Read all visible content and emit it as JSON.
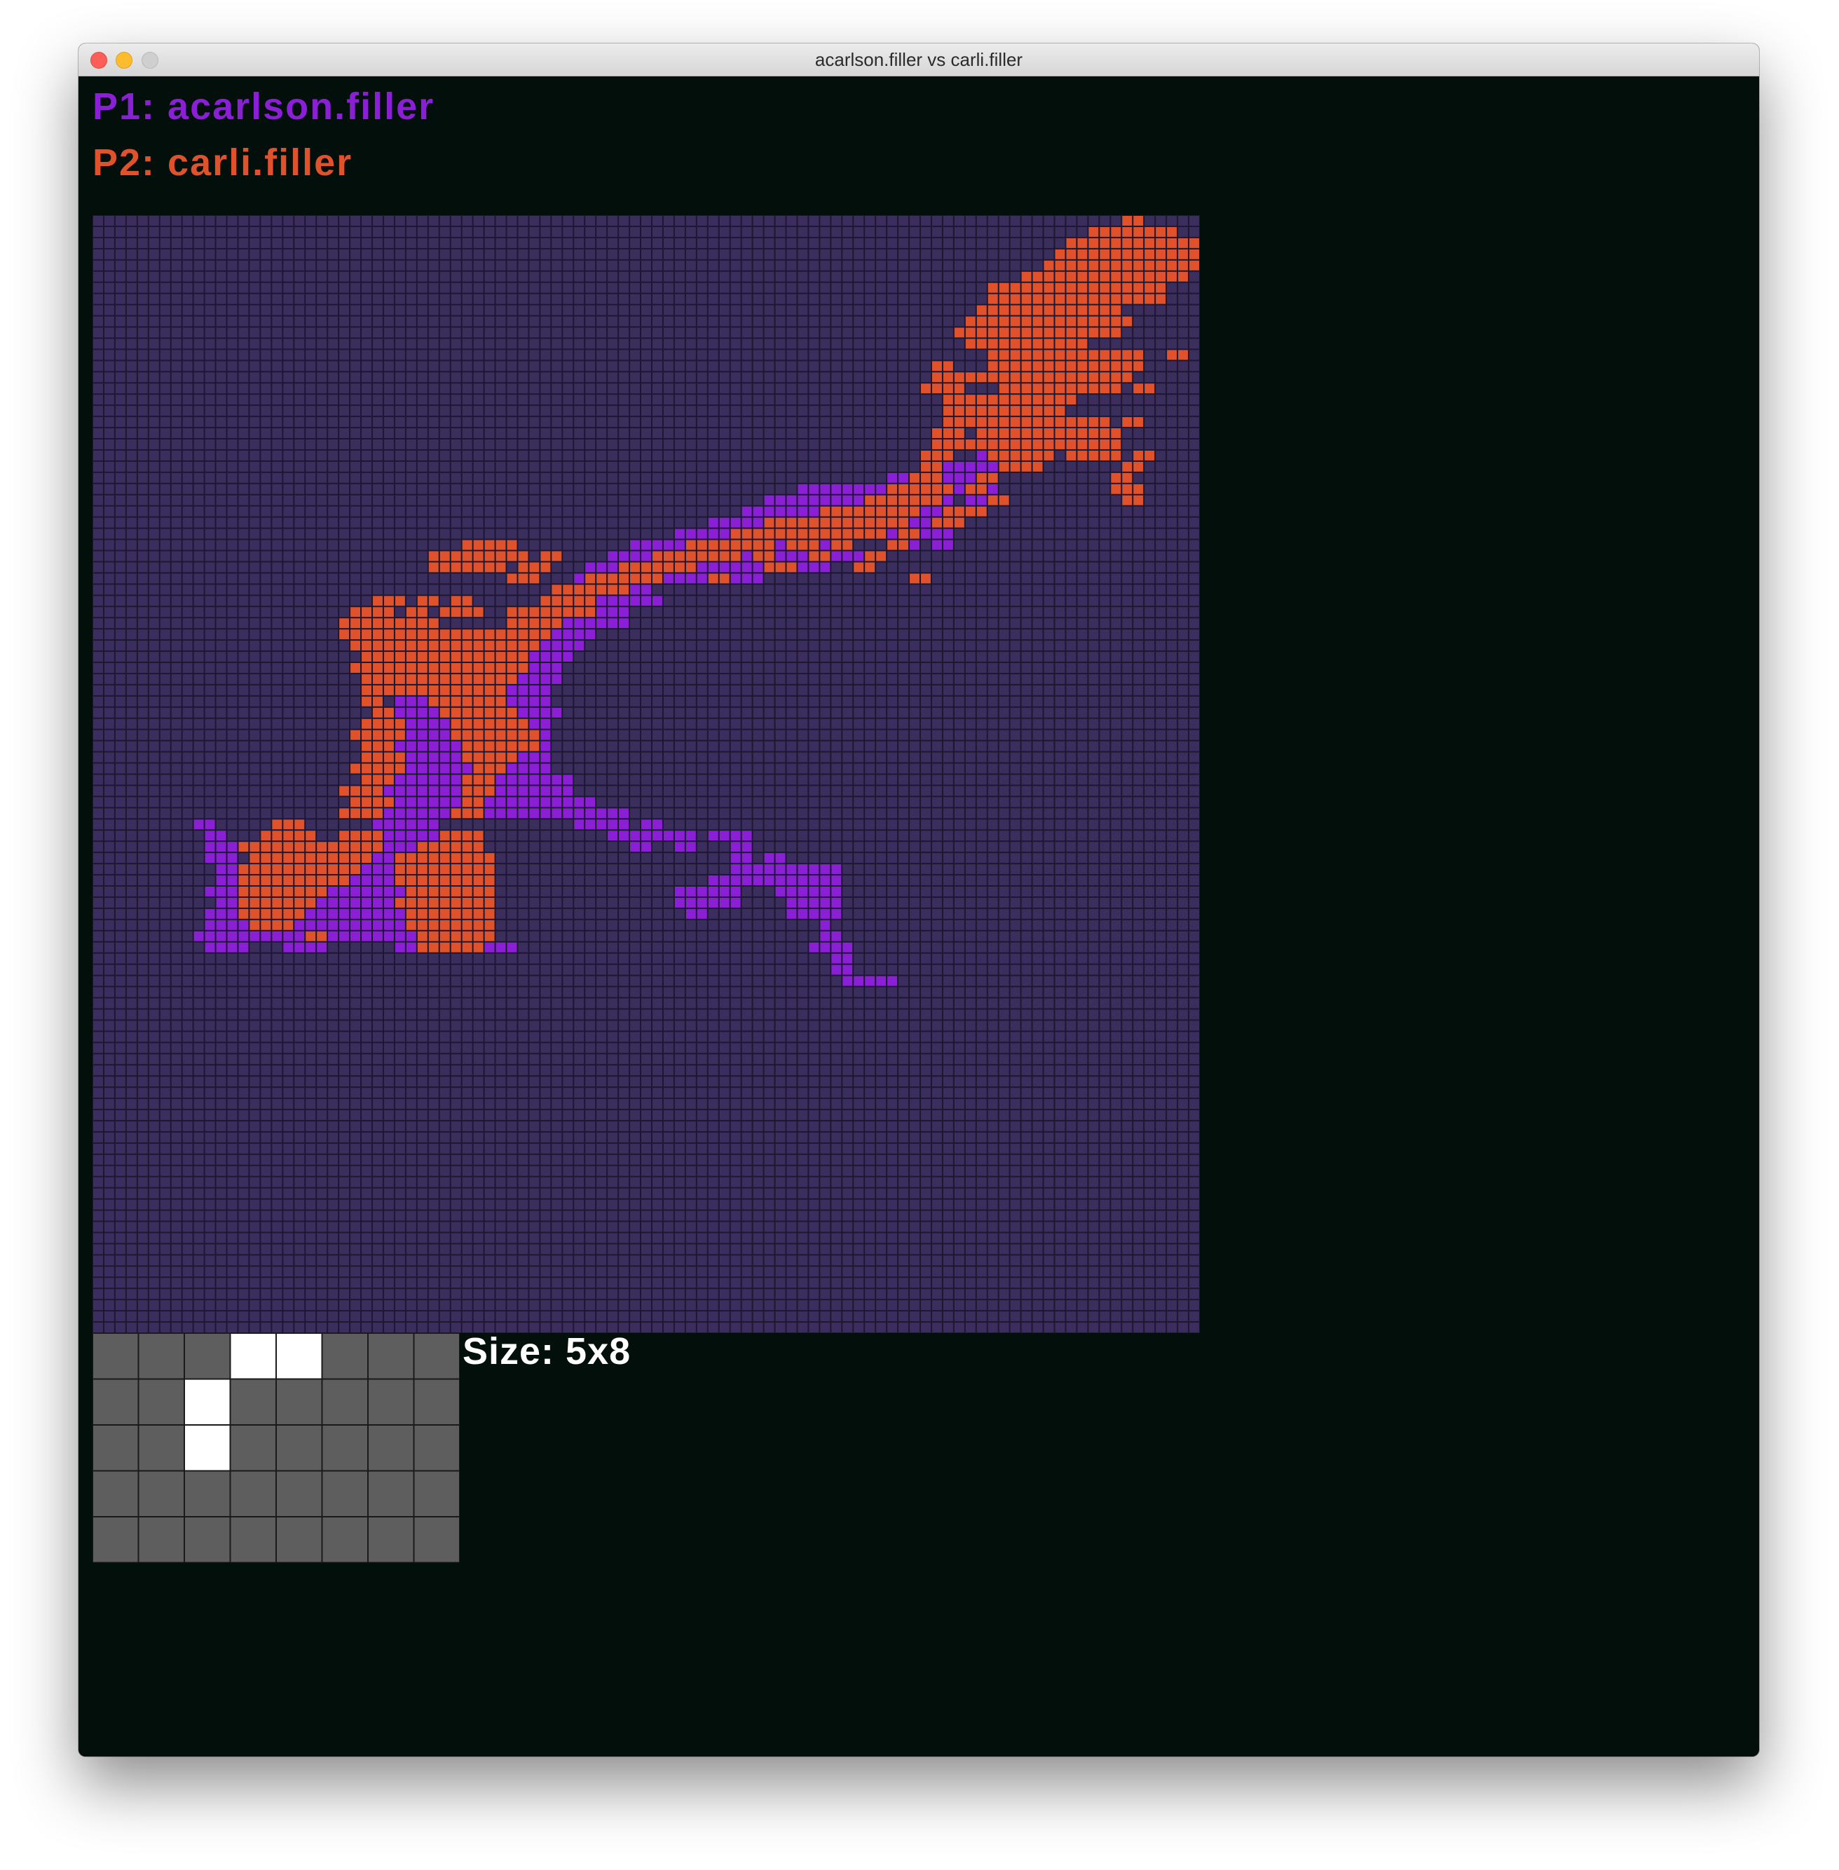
{
  "window": {
    "title": "acarlson.filler vs carli.filler"
  },
  "players": [
    {
      "label": "P1: acarlson.filler",
      "color": "#8a1fd6"
    },
    {
      "label": "P2: carli.filler",
      "color": "#e0522c"
    }
  ],
  "colors": {
    "empty": "#3b2d5e",
    "grid": "#1c1830",
    "piece_empty": "#5e5e5e",
    "piece_filled": "#ffffff",
    "piece_grid": "#1a1a1a"
  },
  "board": {
    "rows": 100,
    "cols": 99,
    "p2_regions": [
      [
        0,
        92,
        0,
        93
      ],
      [
        1,
        89,
        1,
        96
      ],
      [
        2,
        87,
        2,
        98
      ],
      [
        3,
        86,
        3,
        98
      ],
      [
        4,
        85,
        4,
        98
      ],
      [
        5,
        83,
        5,
        97
      ],
      [
        6,
        80,
        7,
        95
      ],
      [
        7,
        83,
        8,
        91
      ],
      [
        8,
        79,
        8,
        86
      ],
      [
        9,
        78,
        9,
        92
      ],
      [
        10,
        77,
        10,
        91
      ],
      [
        11,
        78,
        11,
        88
      ],
      [
        12,
        80,
        13,
        93
      ],
      [
        14,
        82,
        14,
        92
      ],
      [
        15,
        81,
        15,
        91
      ],
      [
        15,
        93,
        15,
        94
      ],
      [
        12,
        96,
        12,
        97
      ],
      [
        16,
        78,
        16,
        87
      ],
      [
        17,
        76,
        17,
        86
      ],
      [
        18,
        77,
        18,
        90
      ],
      [
        19,
        79,
        20,
        91
      ],
      [
        21,
        80,
        21,
        85
      ],
      [
        21,
        90,
        21,
        91
      ],
      [
        22,
        81,
        22,
        82
      ],
      [
        22,
        92,
        22,
        93
      ],
      [
        21,
        93,
        21,
        94
      ],
      [
        13,
        75,
        13,
        76
      ],
      [
        14,
        75,
        14,
        81
      ],
      [
        15,
        74,
        15,
        77
      ],
      [
        16,
        76,
        19,
        77
      ],
      [
        19,
        75,
        20,
        76
      ],
      [
        20,
        78,
        20,
        79
      ],
      [
        21,
        75,
        21,
        76
      ],
      [
        21,
        87,
        21,
        89
      ],
      [
        22,
        83,
        22,
        84
      ],
      [
        17,
        81,
        17,
        82
      ],
      [
        23,
        91,
        23,
        92
      ],
      [
        24,
        91,
        24,
        93
      ],
      [
        25,
        92,
        25,
        93
      ],
      [
        18,
        92,
        18,
        93
      ],
      [
        16,
        77,
        16,
        78
      ],
      [
        17,
        77,
        17,
        79
      ],
      [
        18,
        78,
        18,
        80
      ],
      [
        20,
        76,
        20,
        78
      ],
      [
        21,
        74,
        21,
        75
      ],
      [
        22,
        74,
        22,
        75
      ],
      [
        23,
        73,
        23,
        75
      ],
      [
        24,
        71,
        24,
        76
      ],
      [
        25,
        69,
        25,
        75
      ],
      [
        26,
        65,
        26,
        73
      ],
      [
        27,
        60,
        27,
        72
      ],
      [
        28,
        57,
        28,
        70
      ],
      [
        29,
        53,
        29,
        60
      ],
      [
        30,
        50,
        30,
        57
      ],
      [
        31,
        47,
        31,
        53
      ],
      [
        32,
        44,
        32,
        50
      ],
      [
        33,
        41,
        33,
        47
      ],
      [
        34,
        40,
        34,
        44
      ],
      [
        35,
        38,
        35,
        44
      ],
      [
        36,
        37,
        35,
        39
      ],
      [
        23,
        79,
        23,
        80
      ],
      [
        24,
        78,
        24,
        79
      ],
      [
        25,
        80,
        25,
        81
      ],
      [
        26,
        76,
        26,
        79
      ],
      [
        27,
        75,
        27,
        77
      ],
      [
        28,
        67,
        28,
        69
      ],
      [
        29,
        62,
        29,
        64
      ],
      [
        30,
        59,
        30,
        60
      ],
      [
        36,
        38,
        36,
        41
      ],
      [
        37,
        36,
        37,
        40
      ],
      [
        38,
        36,
        38,
        39
      ],
      [
        39,
        35,
        39,
        38
      ],
      [
        29,
        66,
        29,
        67
      ],
      [
        30,
        69,
        30,
        70
      ],
      [
        31,
        60,
        31,
        61
      ],
      [
        32,
        55,
        32,
        56
      ],
      [
        40,
        35,
        40,
        37
      ],
      [
        41,
        35,
        41,
        37
      ],
      [
        42,
        33,
        42,
        36
      ],
      [
        43,
        33,
        43,
        35
      ],
      [
        30,
        64,
        30,
        65
      ],
      [
        31,
        68,
        31,
        69
      ],
      [
        32,
        73,
        32,
        74
      ],
      [
        31,
        61,
        31,
        62
      ],
      [
        28,
        72,
        28,
        73
      ],
      [
        29,
        71,
        29,
        72
      ],
      [
        27,
        70,
        27,
        71
      ],
      [
        30,
        40,
        30,
        41
      ],
      [
        31,
        38,
        31,
        40
      ],
      [
        32,
        37,
        32,
        39
      ],
      [
        29,
        33,
        29,
        37
      ],
      [
        30,
        30,
        30,
        35
      ],
      [
        30,
        30,
        30,
        38
      ],
      [
        31,
        30,
        31,
        36
      ],
      [
        35,
        23,
        35,
        26
      ],
      [
        36,
        22,
        36,
        30
      ],
      [
        37,
        22,
        37,
        36
      ],
      [
        38,
        23,
        38,
        36
      ],
      [
        39,
        24,
        39,
        37
      ],
      [
        40,
        23,
        40,
        38
      ],
      [
        41,
        24,
        41,
        37
      ],
      [
        42,
        24,
        42,
        36
      ],
      [
        43,
        24,
        43,
        25
      ],
      [
        43,
        30,
        43,
        36
      ],
      [
        44,
        25,
        44,
        26
      ],
      [
        44,
        31,
        44,
        37
      ],
      [
        45,
        24,
        45,
        27
      ],
      [
        45,
        32,
        45,
        38
      ],
      [
        46,
        23,
        46,
        27
      ],
      [
        46,
        32,
        46,
        39
      ],
      [
        47,
        24,
        47,
        26
      ],
      [
        47,
        33,
        47,
        39
      ],
      [
        48,
        24,
        48,
        27
      ],
      [
        48,
        33,
        48,
        37
      ],
      [
        49,
        23,
        49,
        27
      ],
      [
        49,
        34,
        49,
        36
      ],
      [
        50,
        24,
        50,
        26
      ],
      [
        50,
        33,
        50,
        35
      ],
      [
        51,
        22,
        51,
        25
      ],
      [
        51,
        33,
        51,
        35
      ],
      [
        52,
        23,
        52,
        26
      ],
      [
        52,
        33,
        52,
        34
      ],
      [
        53,
        22,
        53,
        25
      ],
      [
        53,
        32,
        53,
        34
      ],
      [
        34,
        25,
        34,
        27
      ],
      [
        34,
        29,
        34,
        30
      ],
      [
        35,
        28,
        35,
        29
      ],
      [
        34,
        32,
        34,
        33
      ],
      [
        35,
        31,
        35,
        34
      ],
      [
        54,
        16,
        54,
        18
      ],
      [
        55,
        15,
        55,
        19
      ],
      [
        55,
        22,
        55,
        25
      ],
      [
        55,
        31,
        55,
        34
      ],
      [
        56,
        13,
        56,
        25
      ],
      [
        56,
        29,
        56,
        34
      ],
      [
        57,
        14,
        57,
        24
      ],
      [
        57,
        27,
        57,
        35
      ],
      [
        58,
        13,
        58,
        23
      ],
      [
        58,
        27,
        58,
        35
      ],
      [
        59,
        13,
        59,
        22
      ],
      [
        59,
        27,
        59,
        35
      ],
      [
        60,
        13,
        60,
        20
      ],
      [
        60,
        28,
        60,
        35
      ],
      [
        61,
        13,
        61,
        19
      ],
      [
        61,
        27,
        61,
        35
      ],
      [
        62,
        13,
        62,
        18
      ],
      [
        62,
        28,
        62,
        35
      ],
      [
        63,
        14,
        63,
        17
      ],
      [
        63,
        28,
        63,
        35
      ],
      [
        64,
        19,
        64,
        20
      ],
      [
        64,
        29,
        64,
        35
      ],
      [
        65,
        29,
        65,
        34
      ],
      [
        64,
        31,
        64,
        33
      ]
    ],
    "p1_regions": [
      [
        21,
        79,
        21,
        80
      ],
      [
        22,
        76,
        22,
        80
      ],
      [
        23,
        71,
        23,
        79
      ],
      [
        24,
        63,
        24,
        77
      ],
      [
        25,
        60,
        25,
        76
      ],
      [
        26,
        58,
        26,
        75
      ],
      [
        27,
        55,
        27,
        65
      ],
      [
        27,
        68,
        27,
        72
      ],
      [
        28,
        52,
        28,
        66
      ],
      [
        28,
        70,
        28,
        73
      ],
      [
        29,
        48,
        29,
        65
      ],
      [
        29,
        73,
        29,
        73
      ],
      [
        30,
        46,
        30,
        58
      ],
      [
        30,
        61,
        30,
        63
      ],
      [
        30,
        66,
        30,
        68
      ],
      [
        31,
        44,
        31,
        59
      ],
      [
        31,
        63,
        31,
        65
      ],
      [
        32,
        43,
        32,
        54
      ],
      [
        32,
        57,
        32,
        59
      ],
      [
        33,
        42,
        33,
        49
      ],
      [
        33,
        47,
        33,
        48
      ],
      [
        34,
        41,
        34,
        50
      ],
      [
        35,
        40,
        35,
        47
      ],
      [
        36,
        38,
        36,
        47
      ],
      [
        37,
        37,
        37,
        44
      ],
      [
        38,
        37,
        38,
        43
      ],
      [
        39,
        36,
        39,
        42
      ],
      [
        40,
        35,
        40,
        41
      ],
      [
        41,
        35,
        41,
        41
      ],
      [
        42,
        34,
        42,
        40
      ],
      [
        43,
        33,
        43,
        40
      ],
      [
        44,
        33,
        44,
        41
      ],
      [
        45,
        35,
        45,
        40
      ],
      [
        46,
        34,
        46,
        40
      ],
      [
        47,
        36,
        47,
        40
      ],
      [
        48,
        35,
        48,
        40
      ],
      [
        49,
        35,
        49,
        40
      ],
      [
        50,
        34,
        50,
        42
      ],
      [
        51,
        33,
        51,
        41
      ],
      [
        52,
        33,
        52,
        41
      ],
      [
        53,
        33,
        53,
        41
      ],
      [
        27,
        73,
        27,
        76
      ],
      [
        28,
        74,
        28,
        76
      ],
      [
        29,
        75,
        29,
        76
      ],
      [
        25,
        78,
        25,
        79
      ],
      [
        26,
        77,
        26,
        79
      ],
      [
        24,
        79,
        24,
        80
      ],
      [
        38,
        29,
        38,
        34
      ],
      [
        39,
        28,
        39,
        35
      ],
      [
        40,
        28,
        40,
        35
      ],
      [
        41,
        28,
        41,
        33
      ],
      [
        42,
        28,
        42,
        33
      ],
      [
        43,
        27,
        43,
        30
      ],
      [
        44,
        27,
        44,
        31
      ],
      [
        45,
        28,
        45,
        32
      ],
      [
        46,
        28,
        46,
        32
      ],
      [
        47,
        27,
        47,
        33
      ],
      [
        48,
        28,
        48,
        33
      ],
      [
        49,
        28,
        49,
        34
      ],
      [
        50,
        27,
        50,
        33
      ],
      [
        51,
        26,
        51,
        33
      ],
      [
        52,
        27,
        52,
        33
      ],
      [
        53,
        26,
        53,
        32
      ],
      [
        54,
        25,
        54,
        30
      ],
      [
        55,
        26,
        55,
        31
      ],
      [
        56,
        25,
        56,
        29
      ],
      [
        57,
        25,
        57,
        27
      ],
      [
        58,
        24,
        58,
        27
      ],
      [
        59,
        23,
        59,
        27
      ],
      [
        60,
        21,
        60,
        28
      ],
      [
        61,
        20,
        61,
        27
      ],
      [
        62,
        19,
        62,
        28
      ],
      [
        63,
        18,
        63,
        28
      ],
      [
        64,
        21,
        64,
        29
      ],
      [
        65,
        27,
        65,
        29
      ],
      [
        65,
        34,
        65,
        37
      ],
      [
        52,
        41,
        52,
        44
      ],
      [
        51,
        41,
        51,
        42
      ],
      [
        53,
        41,
        53,
        45
      ],
      [
        54,
        43,
        54,
        44
      ],
      [
        53,
        46,
        53,
        47
      ],
      [
        54,
        43,
        54,
        47
      ],
      [
        55,
        46,
        55,
        53
      ],
      [
        54,
        49,
        54,
        50
      ],
      [
        55,
        55,
        55,
        58
      ],
      [
        56,
        48,
        56,
        49
      ],
      [
        56,
        52,
        56,
        53
      ],
      [
        56,
        57,
        56,
        58
      ],
      [
        57,
        57,
        57,
        58
      ],
      [
        58,
        57,
        58,
        58
      ],
      [
        59,
        56,
        59,
        58
      ],
      [
        60,
        52,
        60,
        54
      ],
      [
        60,
        53,
        60,
        53
      ],
      [
        60,
        52,
        60,
        55
      ],
      [
        61,
        52,
        61,
        56
      ],
      [
        62,
        53,
        62,
        54
      ],
      [
        59,
        55,
        59,
        57
      ],
      [
        59,
        59,
        59,
        59
      ],
      [
        58,
        59,
        58,
        60
      ],
      [
        57,
        60,
        57,
        61
      ],
      [
        58,
        59,
        58,
        63
      ],
      [
        59,
        60,
        59,
        65
      ],
      [
        60,
        61,
        60,
        66
      ],
      [
        61,
        62,
        61,
        65
      ],
      [
        62,
        62,
        62,
        64
      ],
      [
        59,
        66,
        59,
        66
      ],
      [
        58,
        64,
        58,
        66
      ],
      [
        59,
        64,
        59,
        66
      ],
      [
        60,
        64,
        60,
        66
      ],
      [
        61,
        66,
        61,
        66
      ],
      [
        62,
        65,
        62,
        66
      ],
      [
        63,
        65,
        63,
        65
      ],
      [
        64,
        65,
        64,
        66
      ],
      [
        65,
        64,
        65,
        67
      ],
      [
        66,
        66,
        66,
        67
      ],
      [
        67,
        66,
        67,
        67
      ],
      [
        68,
        67,
        68,
        71
      ],
      [
        54,
        9,
        54,
        10
      ],
      [
        55,
        10,
        55,
        11
      ],
      [
        56,
        10,
        56,
        12
      ],
      [
        57,
        10,
        57,
        12
      ],
      [
        58,
        11,
        58,
        12
      ],
      [
        59,
        11,
        59,
        12
      ],
      [
        60,
        10,
        60,
        12
      ],
      [
        61,
        11,
        61,
        12
      ],
      [
        62,
        10,
        62,
        12
      ],
      [
        63,
        10,
        63,
        13
      ],
      [
        64,
        9,
        64,
        17
      ],
      [
        64,
        18,
        64,
        18
      ],
      [
        65,
        10,
        65,
        13
      ],
      [
        65,
        17,
        65,
        20
      ],
      [
        63,
        18,
        63,
        22
      ],
      [
        62,
        19,
        62,
        22
      ],
      [
        64,
        22,
        64,
        22
      ]
    ],
    "extra_p1": [
      [
        60,
        57
      ],
      [
        60,
        56
      ],
      [
        61,
        57
      ]
    ]
  },
  "piece": {
    "rows": 5,
    "cols": 8,
    "filled": [
      [
        0,
        3
      ],
      [
        0,
        4
      ],
      [
        1,
        2
      ],
      [
        2,
        2
      ]
    ],
    "size_label": "Size: 5x8"
  }
}
